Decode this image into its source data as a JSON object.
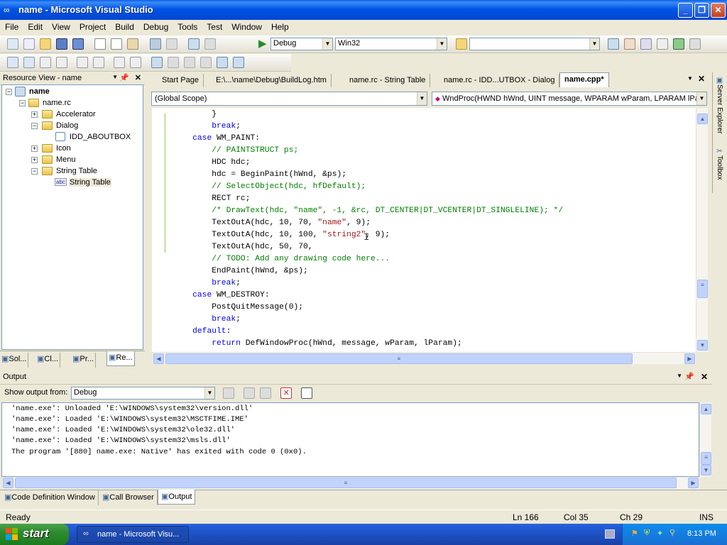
{
  "window": {
    "title": "name - Microsoft Visual Studio"
  },
  "menu": [
    "File",
    "Edit",
    "View",
    "Project",
    "Build",
    "Debug",
    "Tools",
    "Test",
    "Window",
    "Help"
  ],
  "toolbar": {
    "config": "Debug",
    "platform": "Win32",
    "find": ""
  },
  "resource_view": {
    "title": "Resource View - name",
    "nodes": [
      {
        "label": "name",
        "icon": "project-icon"
      },
      {
        "label": "name.rc",
        "icon": "folder-icon"
      },
      {
        "label": "Accelerator",
        "icon": "folder-icon"
      },
      {
        "label": "Dialog",
        "icon": "folder-icon"
      },
      {
        "label": "IDD_ABOUTBOX",
        "icon": "dialog-icon"
      },
      {
        "label": "Icon",
        "icon": "folder-icon"
      },
      {
        "label": "Menu",
        "icon": "folder-icon"
      },
      {
        "label": "String Table",
        "icon": "folder-icon"
      },
      {
        "label": "String Table",
        "icon": "string-table-icon"
      }
    ],
    "bottom_tabs": [
      "Sol...",
      "Cl...",
      "Pr...",
      "Re..."
    ]
  },
  "editor": {
    "tabs": [
      "Start Page",
      "E:\\...\\name\\Debug\\BuildLog.htm",
      "name.rc - String Table",
      "name.rc - IDD...UTBOX - Dialog",
      "name.cpp*"
    ],
    "scope": "(Global Scope)",
    "function": "WndProc(HWND hWnd, UINT message, WPARAM wParam, LPARAM lPara",
    "lines": [
      [
        {
          "t": "        }",
          "c": ""
        }
      ],
      [
        {
          "t": "        ",
          "c": ""
        },
        {
          "t": "break",
          "c": "kw"
        },
        {
          "t": ";",
          "c": ""
        }
      ],
      [
        {
          "t": "    ",
          "c": ""
        },
        {
          "t": "case",
          "c": "kw"
        },
        {
          "t": " WM_PAINT:",
          "c": ""
        }
      ],
      [
        {
          "t": "        ",
          "c": ""
        },
        {
          "t": "// PAINTSTRUCT ps;",
          "c": "cm"
        }
      ],
      [
        {
          "t": "        HDC hdc;",
          "c": ""
        }
      ],
      [
        {
          "t": "        hdc = BeginPaint(hWnd, &ps);",
          "c": ""
        }
      ],
      [
        {
          "t": "        ",
          "c": ""
        },
        {
          "t": "// SelectObject(hdc, hfDefault);",
          "c": "cm"
        }
      ],
      [
        {
          "t": "        RECT rc;",
          "c": ""
        }
      ],
      [
        {
          "t": "        ",
          "c": ""
        },
        {
          "t": "/* DrawText(hdc, \"name\", -1, &rc, DT_CENTER|DT_VCENTER|DT_SINGLELINE); */",
          "c": "cm"
        }
      ],
      [
        {
          "t": "        TextOutA(hdc, 10, 70, ",
          "c": ""
        },
        {
          "t": "\"name\"",
          "c": "st"
        },
        {
          "t": ", 9);",
          "c": ""
        }
      ],
      [
        {
          "t": "        TextOutA(hdc, 10, 100, ",
          "c": ""
        },
        {
          "t": "\"string2\"",
          "c": "st"
        },
        {
          "t": ", 9);",
          "c": ""
        }
      ],
      [
        {
          "t": "        TextOutA(hdc, 50, 70,",
          "c": ""
        }
      ],
      [
        {
          "t": "        ",
          "c": ""
        },
        {
          "t": "// TODO: Add any drawing code here...",
          "c": "cm"
        }
      ],
      [
        {
          "t": "        EndPaint(hWnd, &ps);",
          "c": ""
        }
      ],
      [
        {
          "t": "        ",
          "c": ""
        },
        {
          "t": "break",
          "c": "kw"
        },
        {
          "t": ";",
          "c": ""
        }
      ],
      [
        {
          "t": "    ",
          "c": ""
        },
        {
          "t": "case",
          "c": "kw"
        },
        {
          "t": " WM_DESTROY:",
          "c": ""
        }
      ],
      [
        {
          "t": "        PostQuitMessage(0);",
          "c": ""
        }
      ],
      [
        {
          "t": "        ",
          "c": ""
        },
        {
          "t": "break",
          "c": "kw"
        },
        {
          "t": ";",
          "c": ""
        }
      ],
      [
        {
          "t": "    ",
          "c": ""
        },
        {
          "t": "default",
          "c": "kw"
        },
        {
          "t": ":",
          "c": ""
        }
      ],
      [
        {
          "t": "        ",
          "c": ""
        },
        {
          "t": "return",
          "c": "kw"
        },
        {
          "t": " DefWindowProc(hWnd, message, wParam, lParam);",
          "c": ""
        }
      ]
    ]
  },
  "output": {
    "title": "Output",
    "show_from_label": "Show output from:",
    "source": "Debug",
    "lines": [
      "'name.exe': Unloaded 'E:\\WINDOWS\\system32\\version.dll'",
      "'name.exe': Loaded 'E:\\WINDOWS\\system32\\MSCTFIME.IME'",
      "'name.exe': Loaded 'E:\\WINDOWS\\system32\\ole32.dll'",
      "'name.exe': Loaded 'E:\\WINDOWS\\system32\\msls.dll'",
      "The program '[880] name.exe: Native' has exited with code 0 (0x0)."
    ],
    "bottom_tabs": [
      "Code Definition Window",
      "Call Browser",
      "Output"
    ]
  },
  "side_tabs": [
    "Server Explorer",
    "Toolbox"
  ],
  "status": {
    "text": "Ready",
    "ln": "Ln 166",
    "col": "Col 35",
    "ch": "Ch 29",
    "mode": "INS"
  },
  "taskbar": {
    "start": "start",
    "task": "name - Microsoft Visu...",
    "clock": "8:13 PM"
  },
  "colors": {
    "keyword": "#0000ff",
    "comment": "#008000",
    "string": "#a31515",
    "title_blue": "#0055e5"
  }
}
